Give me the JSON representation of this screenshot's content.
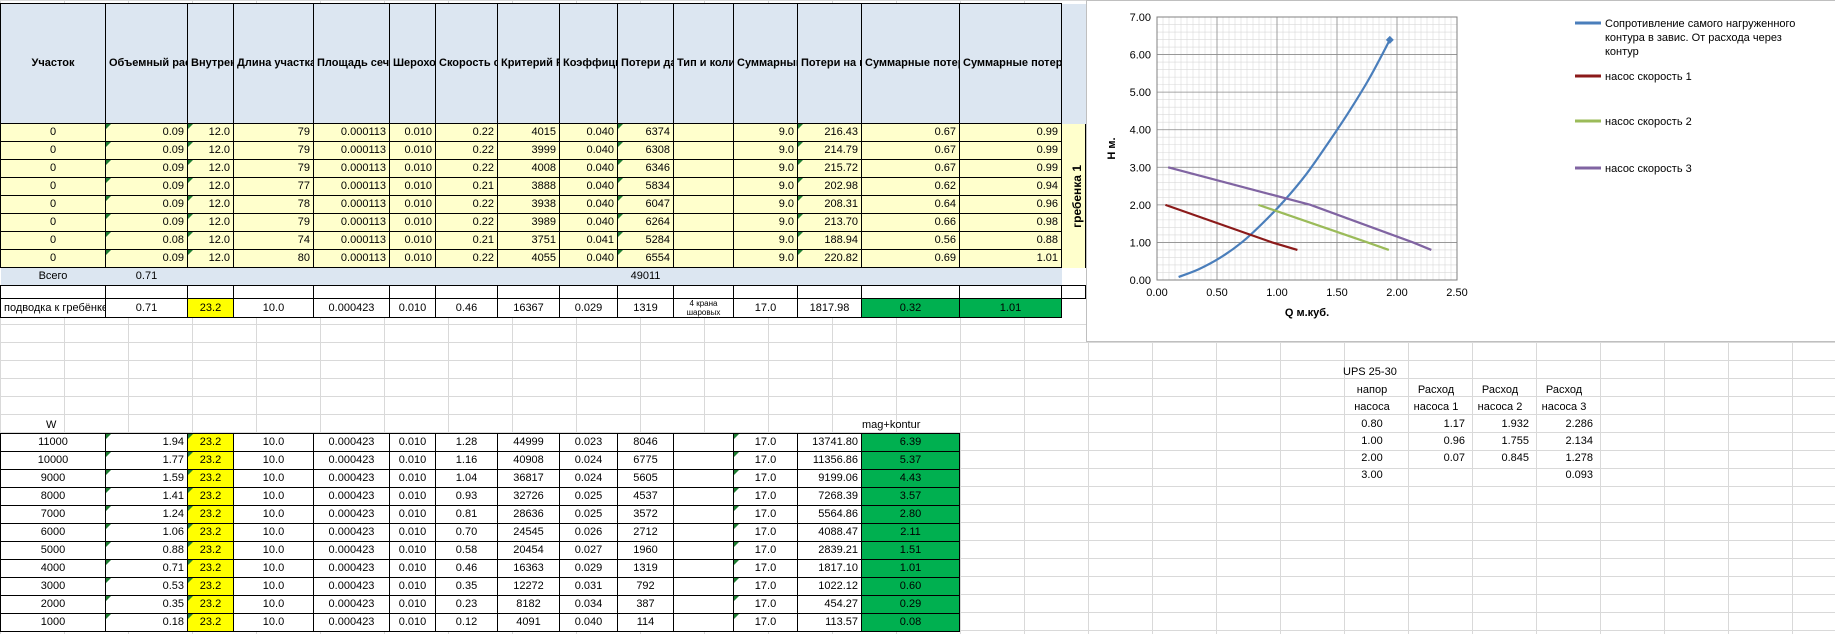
{
  "headers": [
    "Участок",
    "Объемный расход среды на участке, куб.м/ч",
    "Внутренний диаметр трубы участка, мм",
    "Длина участка, м",
    "Площадь сечения трубы, кв.м",
    "Шероховатость стенок трубы, мм",
    "Скорость среды в трубе, м/с",
    "Критерий Рейнольдса",
    "Коэффициент трения",
    "Потери давления на трение, Па",
    "Тип и количество местных сопротивлений",
    "Суммарный коэффициент местных сопротивлений",
    "Потери на местные сопротивления, Па",
    "Суммарные потери давления в трубопроводе, м.в. Ст.",
    "Суммарные потери давления в трубопроводе, подводкой м.в. Ст."
  ],
  "sections": [
    [
      "0",
      "0.09",
      "12.0",
      "79",
      "0.000113",
      "0.010",
      "0.22",
      "4015",
      "0.040",
      "6374",
      "",
      "9.0",
      "216.43",
      "0.67",
      "0.99"
    ],
    [
      "0",
      "0.09",
      "12.0",
      "79",
      "0.000113",
      "0.010",
      "0.22",
      "3999",
      "0.040",
      "6308",
      "",
      "9.0",
      "214.79",
      "0.67",
      "0.99"
    ],
    [
      "0",
      "0.09",
      "12.0",
      "79",
      "0.000113",
      "0.010",
      "0.22",
      "4008",
      "0.040",
      "6346",
      "",
      "9.0",
      "215.72",
      "0.67",
      "0.99"
    ],
    [
      "0",
      "0.09",
      "12.0",
      "77",
      "0.000113",
      "0.010",
      "0.21",
      "3888",
      "0.040",
      "5834",
      "",
      "9.0",
      "202.98",
      "0.62",
      "0.94"
    ],
    [
      "0",
      "0.09",
      "12.0",
      "78",
      "0.000113",
      "0.010",
      "0.22",
      "3938",
      "0.040",
      "6047",
      "",
      "9.0",
      "208.31",
      "0.64",
      "0.96"
    ],
    [
      "0",
      "0.09",
      "12.0",
      "79",
      "0.000113",
      "0.010",
      "0.22",
      "3989",
      "0.040",
      "6264",
      "",
      "9.0",
      "213.70",
      "0.66",
      "0.98"
    ],
    [
      "0",
      "0.08",
      "12.0",
      "74",
      "0.000113",
      "0.010",
      "0.21",
      "3751",
      "0.041",
      "5284",
      "",
      "9.0",
      "188.94",
      "0.56",
      "0.88"
    ],
    [
      "0",
      "0.09",
      "12.0",
      "80",
      "0.000113",
      "0.010",
      "0.22",
      "4055",
      "0.040",
      "6554",
      "",
      "9.0",
      "220.82",
      "0.69",
      "1.01"
    ]
  ],
  "side_label": "гребенка 1",
  "total": {
    "label": "Всего",
    "flow": "0.71",
    "friction": "49011"
  },
  "feed": [
    "подводка к гребёнке",
    "0.71",
    "23.2",
    "10.0",
    "0.000423",
    "0.010",
    "0.46",
    "16367",
    "0.029",
    "1319",
    "4 крана шаровых",
    "17.0",
    "1817.98",
    "0.32",
    "1.01"
  ],
  "w_label": "W",
  "mag_label": "mag+kontur",
  "power_rows": [
    [
      "11000",
      "1.94",
      "23.2",
      "10.0",
      "0.000423",
      "0.010",
      "1.28",
      "44999",
      "0.023",
      "8046",
      "",
      "17.0",
      "13741.80",
      "6.39"
    ],
    [
      "10000",
      "1.77",
      "23.2",
      "10.0",
      "0.000423",
      "0.010",
      "1.16",
      "40908",
      "0.024",
      "6775",
      "",
      "17.0",
      "11356.86",
      "5.37"
    ],
    [
      "9000",
      "1.59",
      "23.2",
      "10.0",
      "0.000423",
      "0.010",
      "1.04",
      "36817",
      "0.024",
      "5605",
      "",
      "17.0",
      "9199.06",
      "4.43"
    ],
    [
      "8000",
      "1.41",
      "23.2",
      "10.0",
      "0.000423",
      "0.010",
      "0.93",
      "32726",
      "0.025",
      "4537",
      "",
      "17.0",
      "7268.39",
      "3.57"
    ],
    [
      "7000",
      "1.24",
      "23.2",
      "10.0",
      "0.000423",
      "0.010",
      "0.81",
      "28636",
      "0.025",
      "3572",
      "",
      "17.0",
      "5564.86",
      "2.80"
    ],
    [
      "6000",
      "1.06",
      "23.2",
      "10.0",
      "0.000423",
      "0.010",
      "0.70",
      "24545",
      "0.026",
      "2712",
      "",
      "17.0",
      "4088.47",
      "2.11"
    ],
    [
      "5000",
      "0.88",
      "23.2",
      "10.0",
      "0.000423",
      "0.010",
      "0.58",
      "20454",
      "0.027",
      "1960",
      "",
      "17.0",
      "2839.21",
      "1.51"
    ],
    [
      "4000",
      "0.71",
      "23.2",
      "10.0",
      "0.000423",
      "0.010",
      "0.46",
      "16363",
      "0.029",
      "1319",
      "",
      "17.0",
      "1817.10",
      "1.01"
    ],
    [
      "3000",
      "0.53",
      "23.2",
      "10.0",
      "0.000423",
      "0.010",
      "0.35",
      "12272",
      "0.031",
      "792",
      "",
      "17.0",
      "1022.12",
      "0.60"
    ],
    [
      "2000",
      "0.35",
      "23.2",
      "10.0",
      "0.000423",
      "0.010",
      "0.23",
      "8182",
      "0.034",
      "387",
      "",
      "17.0",
      "454.27",
      "0.29"
    ],
    [
      "1000",
      "0.18",
      "23.2",
      "10.0",
      "0.000423",
      "0.010",
      "0.12",
      "4091",
      "0.040",
      "114",
      "",
      "17.0",
      "113.57",
      "0.08"
    ]
  ],
  "ups": {
    "title": "UPS 25-30",
    "headers": [
      "напор насоса",
      "Расход насоса 1",
      "Расход насоса 2",
      "Расход насоса 3"
    ],
    "rows": [
      [
        "0.80",
        "1.17",
        "1.932",
        "2.286"
      ],
      [
        "1.00",
        "0.96",
        "1.755",
        "2.134"
      ],
      [
        "2.00",
        "0.07",
        "0.845",
        "1.278"
      ],
      [
        "3.00",
        "",
        "",
        "0.093"
      ]
    ]
  },
  "chart_data": {
    "type": "scatter",
    "xlabel": "Q м.куб.",
    "ylabel": "H м.",
    "xlim": [
      0,
      2.5
    ],
    "ylim": [
      0,
      7
    ],
    "xticks": [
      "0.00",
      "0.50",
      "1.00",
      "1.50",
      "2.00",
      "2.50"
    ],
    "yticks": [
      "0.00",
      "1.00",
      "2.00",
      "3.00",
      "4.00",
      "5.00",
      "6.00",
      "7.00"
    ],
    "grid": true,
    "legend_position": "right",
    "series": [
      {
        "name": "Сопротивление самого нагруженного контура в завис. От расхода через контур",
        "color": "#4a7ebb",
        "points": [
          [
            0.18,
            0.08
          ],
          [
            0.35,
            0.29
          ],
          [
            0.53,
            0.6
          ],
          [
            0.71,
            1.01
          ],
          [
            0.88,
            1.51
          ],
          [
            1.06,
            2.11
          ],
          [
            1.24,
            2.8
          ],
          [
            1.41,
            3.57
          ],
          [
            1.59,
            4.43
          ],
          [
            1.77,
            5.37
          ],
          [
            1.94,
            6.39
          ]
        ]
      },
      {
        "name": "насос скорость 1",
        "color": "#8b1a1a",
        "points": [
          [
            0.07,
            2.0
          ],
          [
            0.96,
            1.0
          ],
          [
            1.17,
            0.8
          ]
        ]
      },
      {
        "name": "насос скорость 2",
        "color": "#9bbb59",
        "points": [
          [
            0.845,
            2.0
          ],
          [
            1.755,
            1.0
          ],
          [
            1.932,
            0.8
          ]
        ]
      },
      {
        "name": "насос скорость 3",
        "color": "#8064a2",
        "points": [
          [
            0.093,
            3.0
          ],
          [
            1.278,
            2.0
          ],
          [
            2.134,
            1.0
          ],
          [
            2.286,
            0.8
          ]
        ]
      }
    ]
  }
}
